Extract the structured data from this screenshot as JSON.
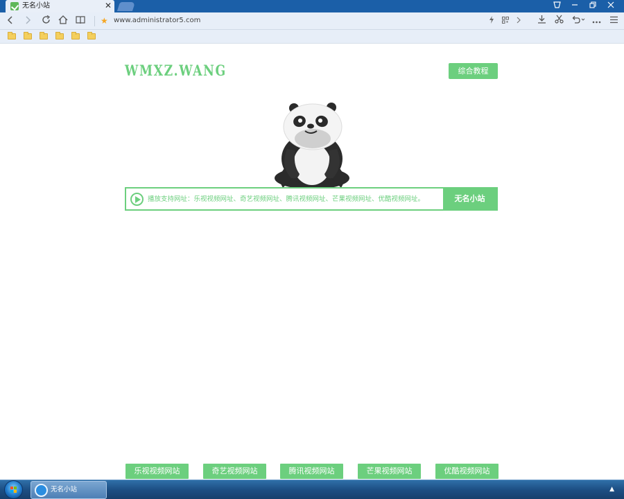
{
  "browser": {
    "tab_title": "无名小站",
    "tab_close": "✕",
    "address": "www.administrator5.com",
    "nav_icons": [
      "back-icon",
      "forward-icon",
      "reload-icon",
      "home-icon",
      "reader-icon"
    ],
    "toolbar_icons": [
      "flash-icon",
      "qr-icon",
      "chevron-right-icon",
      "download-icon",
      "scissors-icon",
      "undo-icon",
      "more-icon",
      "menu-icon"
    ],
    "window_icons": [
      "skin-icon",
      "minimize-icon",
      "restore-icon",
      "close-icon"
    ],
    "bookmark_folder_count": 6
  },
  "page": {
    "logo": "WMXZ.WANG",
    "tutorial_button": "综合教程",
    "player": {
      "placeholder": "播放支持网址：乐视视频网址、奇艺视频网址、腾讯视频网址、芒果视频网址、优酷视频网址。",
      "button": "无名小站"
    },
    "site_links": [
      {
        "label": "乐视视频网站"
      },
      {
        "label": "奇艺视频网站"
      },
      {
        "label": "腾讯视频网站"
      },
      {
        "label": "芒果视频网站"
      },
      {
        "label": "优酷视频网站"
      }
    ],
    "colors": {
      "accent": "#6ccf7e",
      "tab_bar": "#1b5fa8",
      "chrome": "#e7eef8"
    }
  },
  "taskbar": {
    "item_label": "无名小站",
    "tray_arrow": "▲"
  }
}
